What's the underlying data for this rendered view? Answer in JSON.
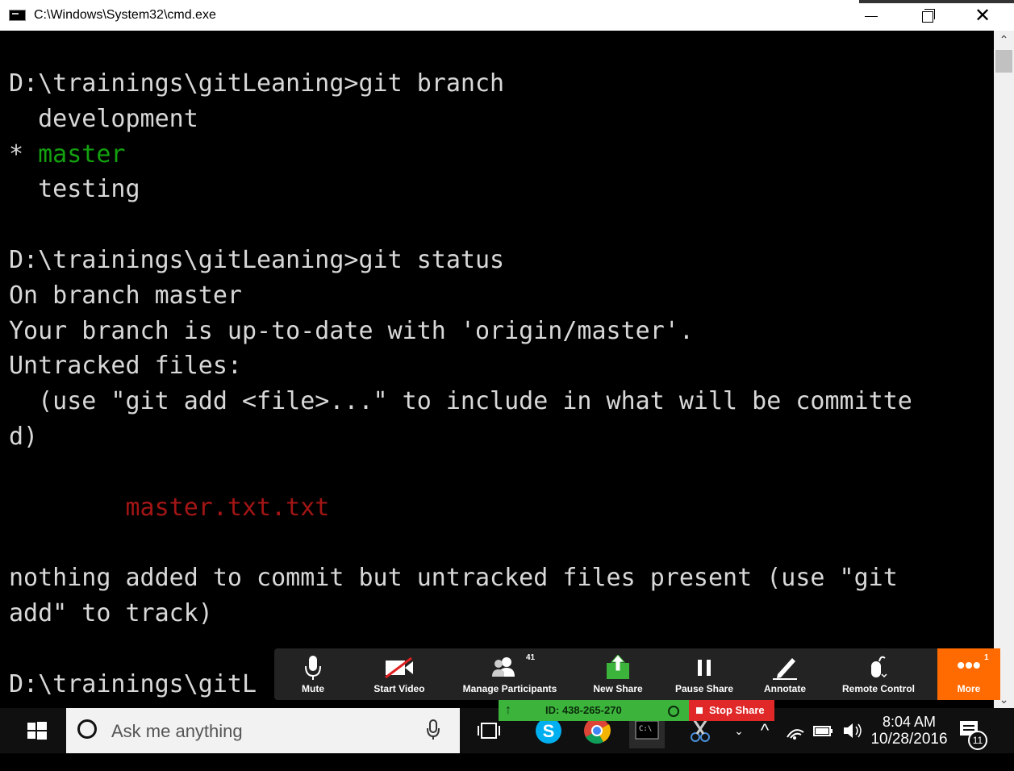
{
  "window": {
    "title": "C:\\Windows\\System32\\cmd.exe",
    "minimize_glyph": "",
    "close_glyph": "✕"
  },
  "console": {
    "lines": [
      {
        "text": "D:\\trainings\\gitLeaning>git branch",
        "color": "default"
      },
      {
        "text": "  development",
        "color": "default"
      },
      {
        "prefix": "* ",
        "text": "master",
        "color": "green"
      },
      {
        "text": "  testing",
        "color": "default"
      },
      {
        "text": "",
        "color": "default"
      },
      {
        "text": "D:\\trainings\\gitLeaning>git status",
        "color": "default"
      },
      {
        "text": "On branch master",
        "color": "default"
      },
      {
        "text": "Your branch is up-to-date with 'origin/master'.",
        "color": "default"
      },
      {
        "text": "Untracked files:",
        "color": "default"
      },
      {
        "text": "  (use \"git add <file>...\" to include in what will be committe",
        "color": "default"
      },
      {
        "text": "d)",
        "color": "default"
      },
      {
        "text": "",
        "color": "default"
      },
      {
        "text": "        master.txt.txt",
        "color": "red"
      },
      {
        "text": "",
        "color": "default"
      },
      {
        "text": "nothing added to commit but untracked files present (use \"git",
        "color": "default"
      },
      {
        "text": "add\" to track)",
        "color": "default"
      },
      {
        "text": "",
        "color": "default"
      },
      {
        "text": "D:\\trainings\\gitL",
        "color": "default"
      }
    ]
  },
  "zoom_toolbar": {
    "mute": "Mute",
    "start_video": "Start Video",
    "manage_participants": "Manage Participants",
    "participant_count": "41",
    "new_share": "New Share",
    "pause_share": "Pause Share",
    "annotate": "Annotate",
    "remote_control": "Remote Control",
    "more": "More",
    "more_badge": "1",
    "accent_color": "#ff6b00"
  },
  "share_status": {
    "meeting_id": "ID: 438-265-270",
    "stop_share": "Stop Share"
  },
  "taskbar": {
    "search_placeholder": "Ask me anything",
    "time": "8:04 AM",
    "date": "10/28/2016",
    "notification_count": "11"
  }
}
